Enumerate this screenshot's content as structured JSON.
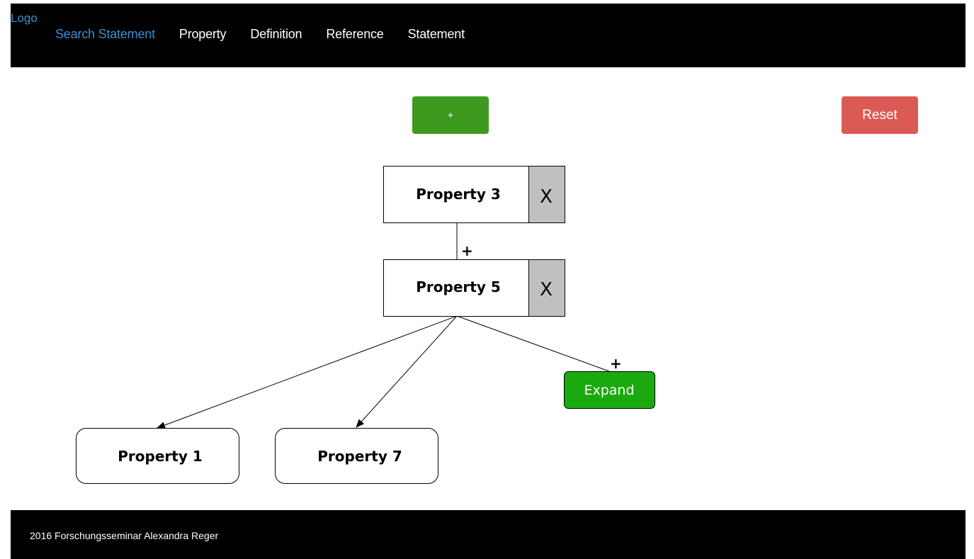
{
  "navbar": {
    "logo": "Logo",
    "links": [
      {
        "label": "Search Statement"
      },
      {
        "label": "Property"
      },
      {
        "label": "Definition"
      },
      {
        "label": "Reference"
      },
      {
        "label": "Statement"
      }
    ],
    "active_link": "Search Statement",
    "background_color": "#000000",
    "active_color": "#3a8fd0"
  },
  "toolbar": {
    "add_label": "+",
    "reset_label": "Reset",
    "add_color": "#3d9a1f",
    "reset_color": "#dc5a55"
  },
  "graph": {
    "nodes": {
      "property3": {
        "label": "Property 3",
        "remove_label": "X"
      },
      "property5": {
        "label": "Property 5",
        "remove_label": "X"
      },
      "property1": {
        "label": "Property 1"
      },
      "property7": {
        "label": "Property 7"
      }
    },
    "edge_labels": {
      "p3_p5": "+",
      "p5_expand": "+"
    },
    "expand_label": "Expand",
    "expand_color": "#1aaa0f",
    "remove_bg_color": "#c0c0c0"
  },
  "footer": {
    "text": "2016 Forschungsseminar Alexandra Reger"
  }
}
